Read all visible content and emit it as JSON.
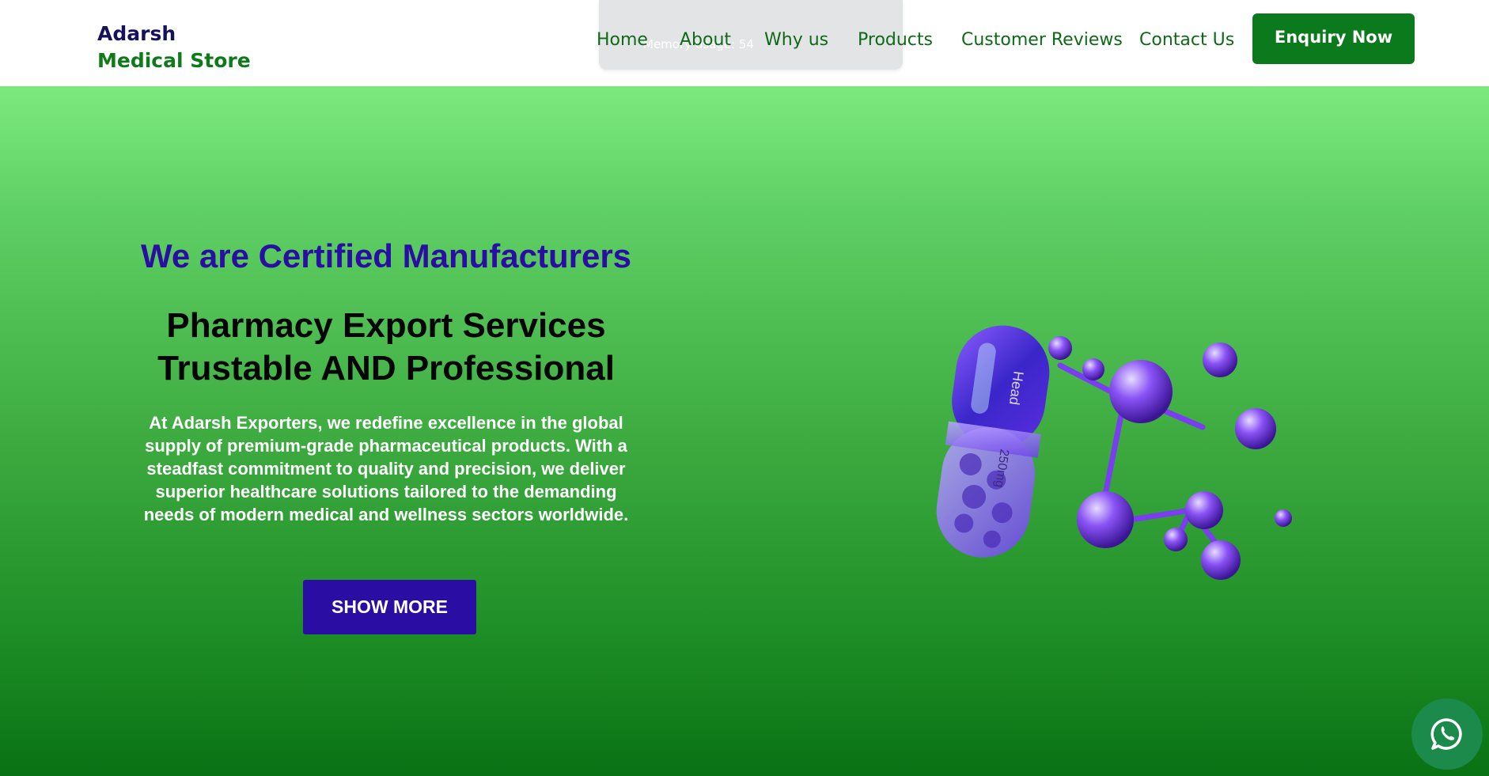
{
  "brand": {
    "line1": "Adarsh",
    "line2": "Medical Store"
  },
  "overlay": {
    "text": "Memory usage: 54"
  },
  "nav": {
    "items": [
      {
        "label": "Home"
      },
      {
        "label": "About"
      },
      {
        "label": "Why us"
      },
      {
        "label": "Products"
      },
      {
        "label": "Customer Reviews"
      },
      {
        "label": "Contact Us"
      }
    ]
  },
  "header": {
    "cta_label": "Enquiry Now"
  },
  "hero": {
    "kicker": "We are Certified Manufacturers",
    "headline_line1": "Pharmacy Export Services",
    "headline_line2": "Trustable AND Professional",
    "description": "At Adarsh Exporters, we redefine excellence in the global supply of premium-grade pharmaceutical products. With a steadfast commitment to quality and precision, we deliver superior healthcare solutions tailored to the demanding needs of modern medical and wellness sectors worldwide.",
    "cta_label": "SHOW MORE",
    "capsule_text_top": "Head",
    "capsule_text_bottom": "250mg"
  },
  "colors": {
    "brand_navy": "#16115c",
    "brand_green": "#0f7a1a",
    "accent_purple": "#2a0ea3",
    "whatsapp_green": "#1c8a4a"
  },
  "icons": {
    "whatsapp": "whatsapp-icon"
  }
}
